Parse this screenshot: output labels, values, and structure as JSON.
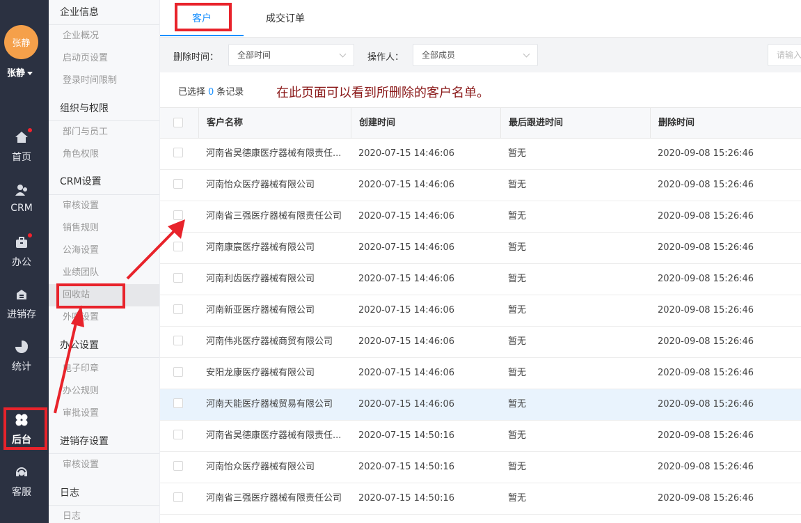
{
  "user": {
    "avatar_text": "张静",
    "name": "张静"
  },
  "rail": {
    "items": [
      {
        "icon": "home-icon",
        "label": "首页",
        "badge": true
      },
      {
        "icon": "crm-icon",
        "label": "CRM",
        "badge": false
      },
      {
        "icon": "briefcase-icon",
        "label": "办公",
        "badge": true
      },
      {
        "icon": "inventory-icon",
        "label": "进销存",
        "badge": false
      },
      {
        "icon": "pie-chart-icon",
        "label": "统计",
        "badge": false
      },
      {
        "icon": "clover-icon",
        "label": "后台",
        "badge": false
      },
      {
        "icon": "headset-icon",
        "label": "客服",
        "badge": false
      }
    ]
  },
  "menu": {
    "groups": [
      {
        "title": "企业信息",
        "items": [
          "企业概况",
          "启动页设置",
          "登录时间限制"
        ]
      },
      {
        "title": "组织与权限",
        "items": [
          "部门与员工",
          "角色权限"
        ]
      },
      {
        "title": "CRM设置",
        "items": [
          "审核设置",
          "销售规则",
          "公海设置",
          "业绩团队",
          "回收站",
          "外呼设置"
        ]
      },
      {
        "title": "办公设置",
        "items": [
          "电子印章",
          "办公规则",
          "审批设置"
        ]
      },
      {
        "title": "进销存设置",
        "items": [
          "审核设置"
        ]
      },
      {
        "title": "日志",
        "items": [
          "日志"
        ]
      }
    ],
    "active_item": "回收站"
  },
  "tabs": {
    "customer": "客户",
    "orders": "成交订单"
  },
  "filters": {
    "delete_time_label": "删除时间：",
    "delete_time_value": "全部时间",
    "operator_label": "操作人：",
    "operator_value": "全部成员",
    "search_placeholder": "请输入"
  },
  "selection": {
    "prefix": "已选择",
    "count": "0",
    "suffix": "条记录"
  },
  "notice": "在此页面可以看到所删除的客户名单。",
  "table": {
    "headers": [
      "客户名称",
      "创建时间",
      "最后跟进时间",
      "删除时间"
    ],
    "rows": [
      [
        "河南省昊德康医疗器械有限责任...",
        "2020-07-15 14:46:06",
        "暂无",
        "2020-09-08 15:26:46"
      ],
      [
        "河南怡众医疗器械有限公司",
        "2020-07-15 14:46:06",
        "暂无",
        "2020-09-08 15:26:46"
      ],
      [
        "河南省三强医疗器械有限责任公司",
        "2020-07-15 14:46:06",
        "暂无",
        "2020-09-08 15:26:46"
      ],
      [
        "河南康宸医疗器械有限公司",
        "2020-07-15 14:46:06",
        "暂无",
        "2020-09-08 15:26:46"
      ],
      [
        "河南利齿医疗器械有限公司",
        "2020-07-15 14:46:06",
        "暂无",
        "2020-09-08 15:26:46"
      ],
      [
        "河南新亚医疗器械有限公司",
        "2020-07-15 14:46:06",
        "暂无",
        "2020-09-08 15:26:46"
      ],
      [
        "河南伟兆医疗器械商贸有限公司",
        "2020-07-15 14:46:06",
        "暂无",
        "2020-09-08 15:26:46"
      ],
      [
        "安阳龙康医疗器械有限公司",
        "2020-07-15 14:46:06",
        "暂无",
        "2020-09-08 15:26:46"
      ],
      [
        "河南天能医疗器械贸易有限公司",
        "2020-07-15 14:46:06",
        "暂无",
        "2020-09-08 15:26:46"
      ],
      [
        "河南省昊德康医疗器械有限责任...",
        "2020-07-15 14:50:16",
        "暂无",
        "2020-09-08 15:26:46"
      ],
      [
        "河南怡众医疗器械有限公司",
        "2020-07-15 14:50:16",
        "暂无",
        "2020-09-08 15:26:46"
      ],
      [
        "河南省三强医疗器械有限责任公司",
        "2020-07-15 14:50:16",
        "暂无",
        "2020-09-08 15:26:46"
      ]
    ],
    "highlighted_row": 8
  },
  "colors": {
    "accent": "#1890ff",
    "annotation": "#e8232b",
    "rail": "#2b3141",
    "avatar": "#f5a04a",
    "notice": "#8b1a1a"
  }
}
